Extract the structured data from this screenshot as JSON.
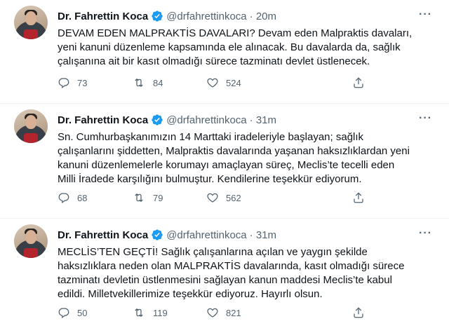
{
  "tweets": [
    {
      "author": "Dr. Fahrettin Koca",
      "handle": "@drfahrettinkoca",
      "time": "· 20m",
      "text": "DEVAM EDEN MALPRAKTİS DAVALARI? Devam eden Malpraktis davaları,\nyeni kanuni düzenleme kapsamında ele alınacak. Bu davalarda da, sağlık\nçalışanına ait bir kasıt olmadığı sürece tazminatı devlet üstlenecek.",
      "replies": "73",
      "retweets": "84",
      "likes": "524"
    },
    {
      "author": "Dr. Fahrettin Koca",
      "handle": "@drfahrettinkoca",
      "time": "· 31m",
      "text": "Sn. Cumhurbaşkanımızın 14 Marttaki iradeleriyle başlayan; sağlık\nçalışanlarını şiddetten, Malpraktis davalarında yaşanan haksızlıklardan yeni\nkanuni düzenlemelerle korumayı amaçlayan süreç, Meclis’te tecelli eden\nMilli İradede karşılığını bulmuştur. Kendilerine teşekkür ediyorum.",
      "replies": "68",
      "retweets": "79",
      "likes": "562"
    },
    {
      "author": "Dr. Fahrettin Koca",
      "handle": "@drfahrettinkoca",
      "time": "· 31m",
      "text": "MECLİS’TEN GEÇTİ! Sağlık çalışanlarına açılan ve yaygın şekilde\nhaksızlıklara neden olan MALPRAKTİS davalarında, kasıt olmadığı sürece\ntazminatı devletin üstlenmesini sağlayan kanun maddesi Meclis’te kabul\nedildi. Milletvekillerimize teşekkür ediyoruz. Hayırlı olsun.",
      "replies": "50",
      "retweets": "119",
      "likes": "821"
    }
  ],
  "more_label": "···",
  "colors": {
    "verified": "#1d9bf0",
    "muted": "#536471",
    "text": "#0f1419",
    "divider": "#eff3f4"
  },
  "icons": [
    "verified-badge-icon",
    "reply-icon",
    "retweet-icon",
    "like-icon",
    "share-icon",
    "more-icon"
  ]
}
